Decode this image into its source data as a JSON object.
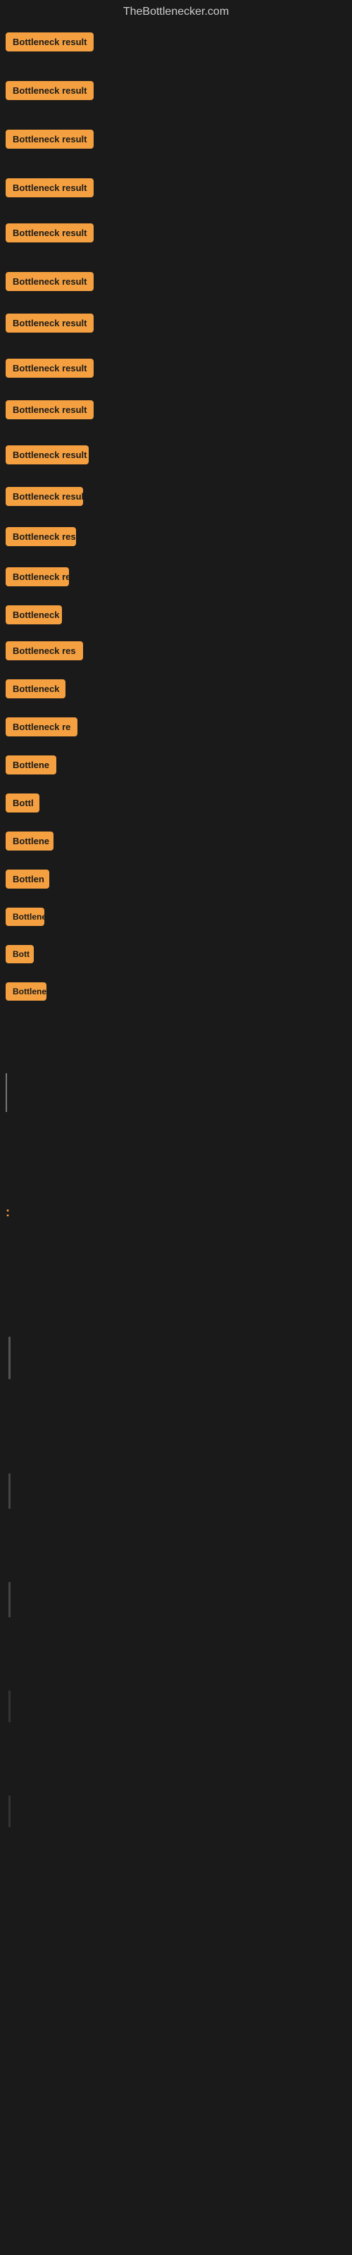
{
  "site": {
    "title": "TheBottlenecker.com"
  },
  "items": [
    {
      "id": 1,
      "label": "Bottleneck result",
      "badgeClass": "badge-full",
      "spacing": 30
    },
    {
      "id": 2,
      "label": "Bottleneck result",
      "badgeClass": "badge-1",
      "spacing": 30
    },
    {
      "id": 3,
      "label": "Bottleneck result",
      "badgeClass": "badge-2",
      "spacing": 30
    },
    {
      "id": 4,
      "label": "Bottleneck result",
      "badgeClass": "badge-3",
      "spacing": 30
    },
    {
      "id": 5,
      "label": "Bottleneck result",
      "badgeClass": "badge-4",
      "spacing": 30
    },
    {
      "id": 6,
      "label": "Bottleneck result",
      "badgeClass": "badge-5",
      "spacing": 30
    },
    {
      "id": 7,
      "label": "Bottleneck result",
      "badgeClass": "badge-6",
      "spacing": 25
    },
    {
      "id": 8,
      "label": "Bottleneck result",
      "badgeClass": "badge-7",
      "spacing": 25
    },
    {
      "id": 9,
      "label": "Bottleneck result",
      "badgeClass": "badge-8",
      "spacing": 25
    },
    {
      "id": 10,
      "label": "Bottleneck result",
      "badgeClass": "badge-9",
      "spacing": 20
    },
    {
      "id": 11,
      "label": "Bottleneck result",
      "badgeClass": "badge-10",
      "spacing": 20
    },
    {
      "id": 12,
      "label": "Bottleneck result",
      "badgeClass": "badge-11",
      "spacing": 20
    },
    {
      "id": 13,
      "label": "Bottleneck result",
      "badgeClass": "badge-12",
      "spacing": 18
    },
    {
      "id": 14,
      "label": "Bottleneck result",
      "badgeClass": "badge-13",
      "spacing": 15
    },
    {
      "id": 15,
      "label": "Bottleneck res",
      "badgeClass": "badge-14",
      "spacing": 12
    },
    {
      "id": 16,
      "label": "Bottleneck",
      "badgeClass": "badge-15",
      "spacing": 12
    },
    {
      "id": 17,
      "label": "Bottleneck re",
      "badgeClass": "badge-15",
      "spacing": 12
    },
    {
      "id": 18,
      "label": "Bottlene",
      "badgeClass": "badge-16",
      "spacing": 10
    },
    {
      "id": 19,
      "label": "Bottl",
      "badgeClass": "badge-17",
      "spacing": 10
    },
    {
      "id": 20,
      "label": "Bottlene",
      "badgeClass": "badge-18",
      "spacing": 10
    },
    {
      "id": 21,
      "label": "Bottlen",
      "badgeClass": "badge-19",
      "spacing": 8
    },
    {
      "id": 22,
      "label": "Bottleneck",
      "badgeClass": "badge-20",
      "spacing": 8
    },
    {
      "id": 23,
      "label": "Bott",
      "badgeClass": "badge-20",
      "spacing": 8
    },
    {
      "id": 24,
      "label": "Bottlene",
      "badgeClass": "badge-20",
      "spacing": 8
    }
  ],
  "bottom_markers": [
    {
      "id": 1,
      "type": "line"
    },
    {
      "id": 2,
      "type": "dot"
    },
    {
      "id": 3,
      "type": "dot"
    },
    {
      "id": 4,
      "type": "dot"
    },
    {
      "id": 5,
      "type": "dot"
    }
  ],
  "colon_label": ":"
}
